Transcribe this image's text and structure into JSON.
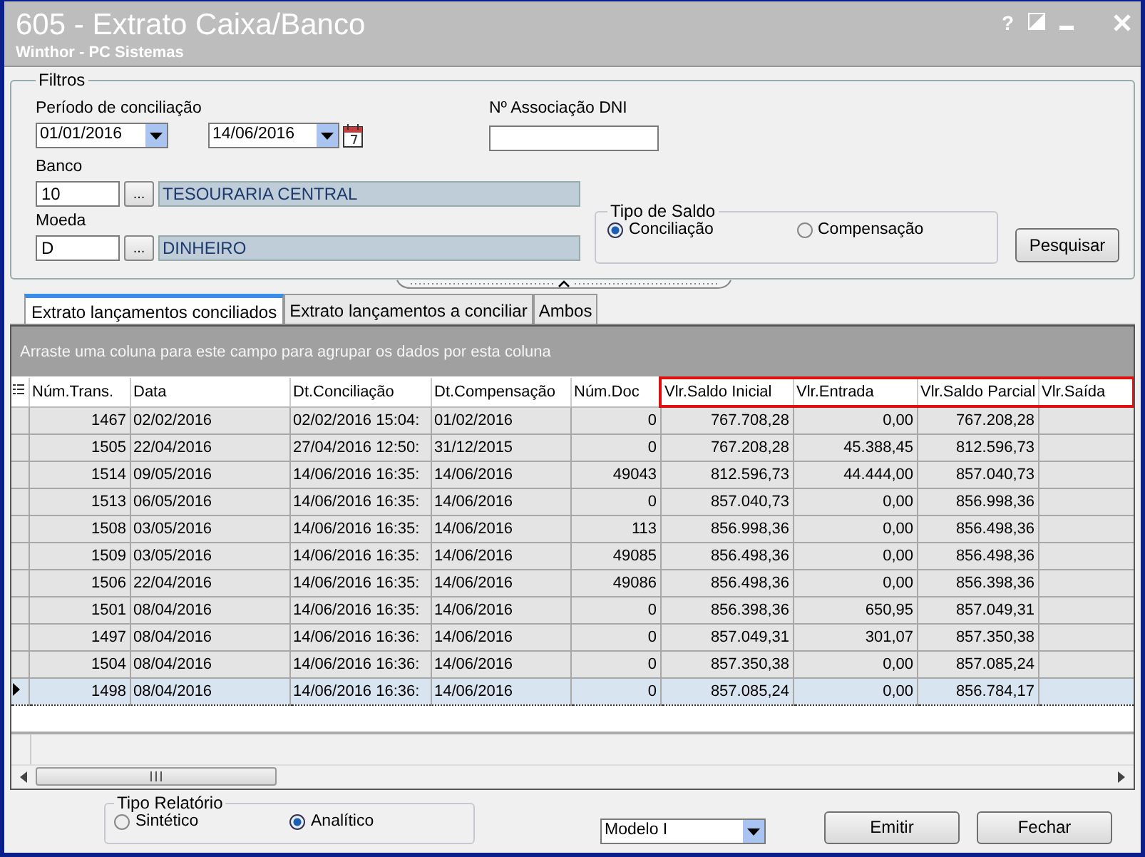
{
  "window": {
    "title": "605 - Extrato Caixa/Banco",
    "subtitle": "Winthor - PC Sistemas",
    "help": "?"
  },
  "filters": {
    "legend": "Filtros",
    "period_label": "Período de conciliação",
    "date_from": "01/01/2016",
    "date_to": "14/06/2016",
    "dni_label": "Nº Associação DNI",
    "banco_label": "Banco",
    "banco_code": "10",
    "banco_name": "TESOURARIA CENTRAL",
    "moeda_label": "Moeda",
    "moeda_code": "D",
    "moeda_name": "DINHEIRO",
    "lookup": "...",
    "saldo_legend": "Tipo de Saldo",
    "saldo_options": [
      {
        "label": "Conciliação",
        "selected": true
      },
      {
        "label": "Compensação",
        "selected": false
      }
    ],
    "search_button": "Pesquisar"
  },
  "tabs": [
    {
      "label": "Extrato lançamentos conciliados",
      "selected": true
    },
    {
      "label": "Extrato lançamentos a conciliar",
      "selected": false
    },
    {
      "label": "Ambos",
      "selected": false
    }
  ],
  "group_panel": "Arraste uma coluna para este campo para agrupar os dados por esta coluna",
  "table": {
    "columns": [
      {
        "label": "Núm.Trans.",
        "highlighted": false
      },
      {
        "label": "Data",
        "highlighted": false
      },
      {
        "label": "Dt.Conciliação",
        "highlighted": false
      },
      {
        "label": "Dt.Compensação",
        "highlighted": false
      },
      {
        "label": "Núm.Doc",
        "highlighted": false
      },
      {
        "label": "Vlr.Saldo Inicial",
        "highlighted": true
      },
      {
        "label": "Vlr.Entrada",
        "highlighted": true
      },
      {
        "label": "Vlr.Saldo Parcial",
        "highlighted": true
      },
      {
        "label": "Vlr.Saída",
        "highlighted": true
      }
    ],
    "rows": [
      {
        "selected": false,
        "cells": [
          "1467",
          "02/02/2016",
          "02/02/2016 15:04:",
          "01/02/2016",
          "0",
          "767.708,28",
          "0,00",
          "767.208,28",
          ""
        ]
      },
      {
        "selected": false,
        "cells": [
          "1505",
          "22/04/2016",
          "27/04/2016 12:50:",
          "31/12/2015",
          "0",
          "767.208,28",
          "45.388,45",
          "812.596,73",
          ""
        ]
      },
      {
        "selected": false,
        "cells": [
          "1514",
          "09/05/2016",
          "14/06/2016 16:35:",
          "14/06/2016",
          "49043",
          "812.596,73",
          "44.444,00",
          "857.040,73",
          ""
        ]
      },
      {
        "selected": false,
        "cells": [
          "1513",
          "06/05/2016",
          "14/06/2016 16:35:",
          "14/06/2016",
          "0",
          "857.040,73",
          "0,00",
          "856.998,36",
          ""
        ]
      },
      {
        "selected": false,
        "cells": [
          "1508",
          "03/05/2016",
          "14/06/2016 16:35:",
          "14/06/2016",
          "113",
          "856.998,36",
          "0,00",
          "856.498,36",
          ""
        ]
      },
      {
        "selected": false,
        "cells": [
          "1509",
          "03/05/2016",
          "14/06/2016 16:35:",
          "14/06/2016",
          "49085",
          "856.498,36",
          "0,00",
          "856.498,36",
          ""
        ]
      },
      {
        "selected": false,
        "cells": [
          "1506",
          "22/04/2016",
          "14/06/2016 16:35:",
          "14/06/2016",
          "49086",
          "856.498,36",
          "0,00",
          "856.398,36",
          ""
        ]
      },
      {
        "selected": false,
        "cells": [
          "1501",
          "08/04/2016",
          "14/06/2016 16:35:",
          "14/06/2016",
          "0",
          "856.398,36",
          "650,95",
          "857.049,31",
          ""
        ]
      },
      {
        "selected": false,
        "cells": [
          "1497",
          "08/04/2016",
          "14/06/2016 16:36:",
          "14/06/2016",
          "0",
          "857.049,31",
          "301,07",
          "857.350,38",
          ""
        ]
      },
      {
        "selected": false,
        "cells": [
          "1504",
          "08/04/2016",
          "14/06/2016 16:36:",
          "14/06/2016",
          "0",
          "857.350,38",
          "0,00",
          "857.085,24",
          ""
        ]
      },
      {
        "selected": true,
        "cells": [
          "1498",
          "08/04/2016",
          "14/06/2016 16:36:",
          "14/06/2016",
          "0",
          "857.085,24",
          "0,00",
          "856.784,17",
          ""
        ]
      }
    ]
  },
  "report": {
    "legend": "Tipo Relatório",
    "options": [
      {
        "label": "Sintético",
        "selected": false
      },
      {
        "label": "Analítico",
        "selected": true
      }
    ],
    "model": "Modelo I",
    "buttons": [
      "Emitir",
      "Fechar"
    ]
  }
}
